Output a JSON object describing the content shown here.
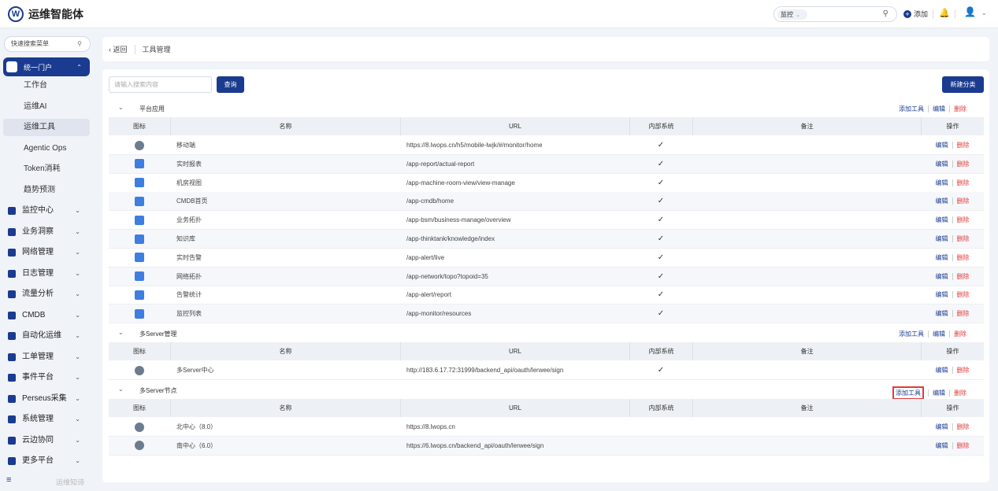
{
  "app": {
    "title": "运维智能体",
    "logo_char": "W"
  },
  "topbar": {
    "search_scope": "监控",
    "add_label": "添加"
  },
  "sidebar": {
    "search_placeholder": "快速搜索菜单",
    "portal": {
      "label": "统一门户",
      "items": [
        "工作台",
        "运维AI",
        "运维工具",
        "Agentic Ops",
        "Token消耗",
        "趋势预测"
      ],
      "active_index": 2
    },
    "groups": [
      "监控中心",
      "业务洞察",
      "网络管理",
      "日志管理",
      "流量分析",
      "CMDB",
      "自动化运维",
      "工单管理",
      "事件平台",
      "Perseus采集",
      "系统管理",
      "云边协同",
      "更多平台"
    ],
    "footer": "运维知诗"
  },
  "breadcrumb": {
    "back": "返回",
    "current": "工具管理"
  },
  "toolbar": {
    "search_placeholder": "请输入搜索内容",
    "query": "查询",
    "new_category": "新建分类"
  },
  "columns": {
    "icon": "图标",
    "name": "名称",
    "url": "URL",
    "internal": "内部系统",
    "note": "备注",
    "ops": "操作"
  },
  "actions": {
    "add_tool": "添加工具",
    "edit": "编辑",
    "delete": "删除"
  },
  "sections": [
    {
      "name": "平台应用",
      "rows": [
        {
          "icon": "chat-icon",
          "name": "移动端",
          "url": "https://8.lwops.cn/h5/mobile-lwjk/#/monitor/home",
          "internal": true
        },
        {
          "icon": "report-icon",
          "name": "实时报表",
          "url": "/app-report/actual-report",
          "internal": true
        },
        {
          "icon": "building-icon",
          "name": "机房视图",
          "url": "/app-machine-room-view/view-manage",
          "internal": true
        },
        {
          "icon": "cmdb-icon",
          "name": "CMDB首页",
          "url": "/app-cmdb/home",
          "internal": true
        },
        {
          "icon": "topology-icon",
          "name": "业务拓扑",
          "url": "/app-bsm/business-manage/overview",
          "internal": true
        },
        {
          "icon": "knowledge-icon",
          "name": "知识库",
          "url": "/app-thinktank/knowledge/index",
          "internal": true
        },
        {
          "icon": "alert-icon",
          "name": "实时告警",
          "url": "/app-alert/live",
          "internal": true
        },
        {
          "icon": "network-icon",
          "name": "网络拓扑",
          "url": "/app-network/topo?topoid=35",
          "internal": true
        },
        {
          "icon": "stats-icon",
          "name": "告警统计",
          "url": "/app-alert/report",
          "internal": true
        },
        {
          "icon": "list-icon",
          "name": "监控列表",
          "url": "/app-monitor/resources",
          "internal": true
        }
      ]
    },
    {
      "name": "多Server管理",
      "rows": [
        {
          "icon": "globe-icon",
          "name": "多Server中心",
          "url": "http://183.6.17.72:31999/backend_api/oauth/lerwee/sign",
          "internal": true
        }
      ]
    },
    {
      "name": "多Server节点",
      "rows": [
        {
          "icon": "globe-icon",
          "name": "北中心（8.0）",
          "url": "https://8.lwops.cn",
          "internal": false
        },
        {
          "icon": "globe-icon",
          "name": "南中心（6.0）",
          "url": "https://6.lwops.cn/backend_api/oauth/lerwee/sign",
          "internal": false
        }
      ]
    }
  ],
  "colors": {
    "brand": "#1a3b8f",
    "danger": "#e23b3b"
  }
}
